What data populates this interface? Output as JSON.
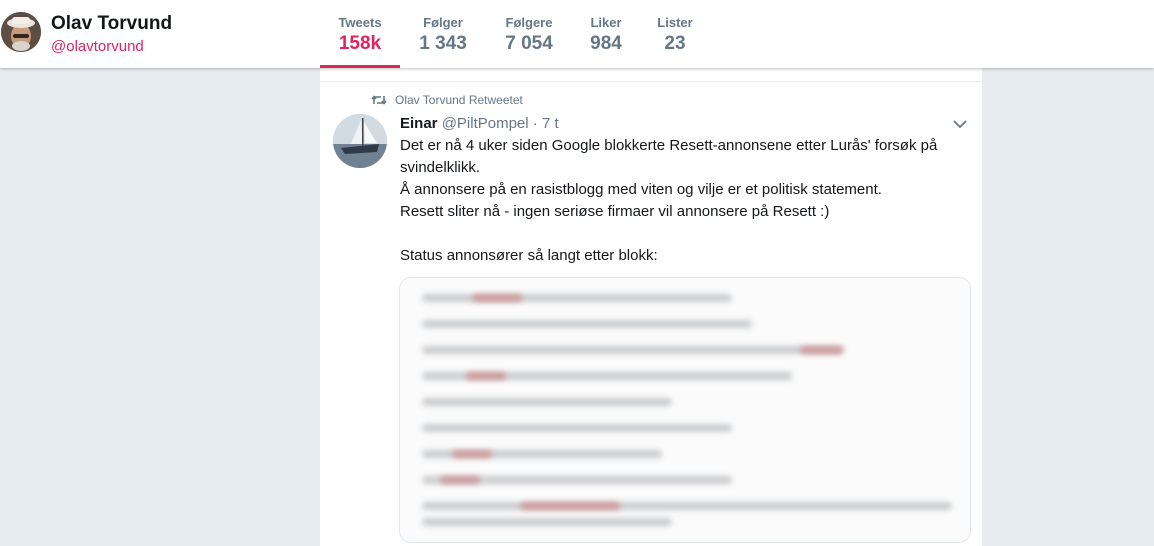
{
  "profile": {
    "name": "Olav Torvund",
    "handle": "@olavtorvund"
  },
  "nav": {
    "stats": [
      {
        "label": "Tweets",
        "value": "158k",
        "active": true
      },
      {
        "label": "Følger",
        "value": "1 343",
        "active": false
      },
      {
        "label": "Følgere",
        "value": "7 054",
        "active": false
      },
      {
        "label": "Liker",
        "value": "984",
        "active": false
      },
      {
        "label": "Lister",
        "value": "23",
        "active": false
      }
    ]
  },
  "tweet": {
    "context": "Olav Torvund Retweetet",
    "author_name": "Einar",
    "author_handle": "@PiltPompel",
    "time": " · 7 t",
    "text": "Det er nå 4 uker siden Google blokkerte Resett-annonsene etter Lurås' forsøk på svindelklikk.\nÅ annonsere på en rasistblogg med viten og vilje er et politisk statement.\nResett sliter nå - ingen seriøse firmaer vil annonsere på Resett :)\n\nStatus annonsører så langt etter blokk:"
  },
  "icons": {
    "retweet": "retweet-icon",
    "caret": "chevron-down-icon"
  },
  "colors": {
    "accent": "#e0245e",
    "secondary_text": "#657786",
    "background": "#e6ecf0"
  }
}
